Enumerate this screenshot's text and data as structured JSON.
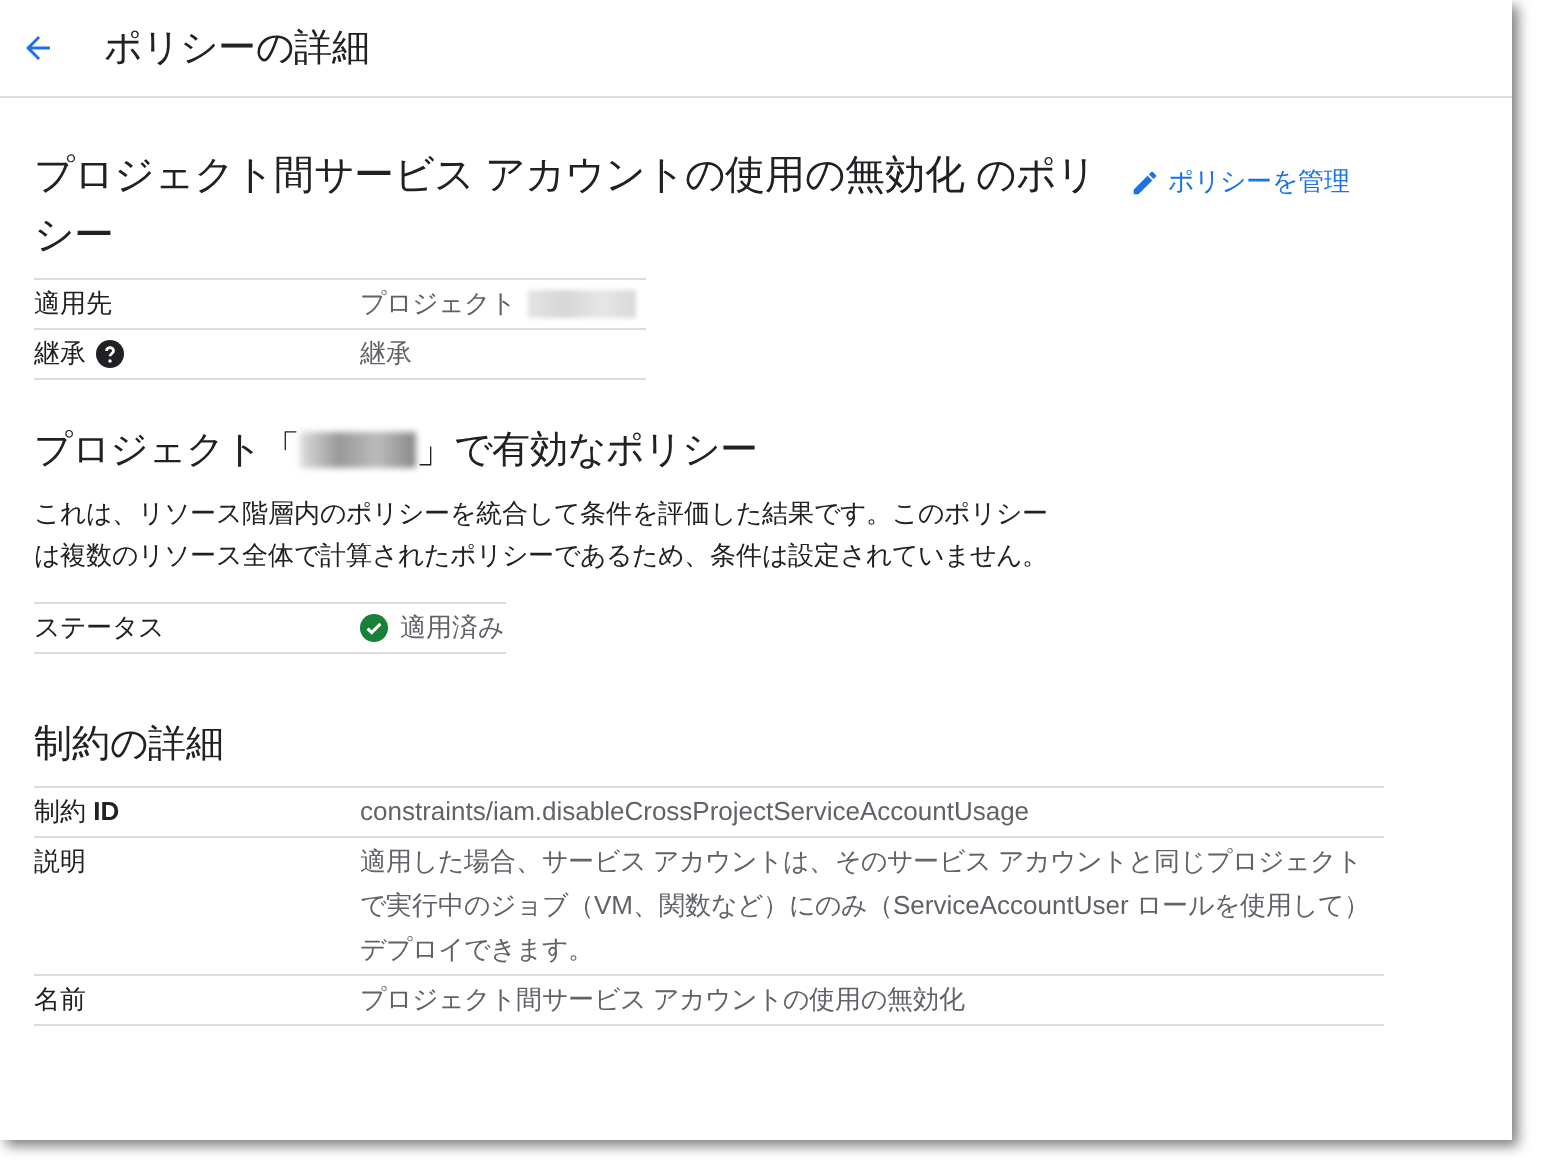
{
  "header": {
    "title": "ポリシーの詳細"
  },
  "policy": {
    "title": "プロジェクト間サービス アカウントの使用の無効化 のポリシー",
    "manage_link": "ポリシーを管理"
  },
  "summary_rows": [
    {
      "kind": "redacted",
      "label": "適用先",
      "value": "プロジェクト"
    },
    {
      "kind": "help",
      "label": "継承",
      "value": "継承"
    }
  ],
  "effective": {
    "title_before": "プロジェクト「",
    "title_after": "」で有効なポリシー",
    "description": "これは、リソース階層内のポリシーを統合して条件を評価した結果です。このポリシーは複数のリソース全体で計算されたポリシーであるため、条件は設定されていません。",
    "status_label": "ステータス",
    "status_value": "適用済み"
  },
  "constraint": {
    "title": "制約の詳細",
    "rows": [
      {
        "label": "制約 **ID**",
        "value": "constraints/iam.disableCrossProjectServiceAccountUsage"
      },
      {
        "label": "説明",
        "value": "適用した場合、サービス アカウントは、そのサービス アカウントと同じプロジェクトで実行中のジョブ（VM、関数など）にのみ（ServiceAccountUser ロールを使用して）デプロイできます。"
      },
      {
        "label": "名前",
        "value": "プロジェクト間サービス アカウントの使用の無効化"
      }
    ]
  }
}
